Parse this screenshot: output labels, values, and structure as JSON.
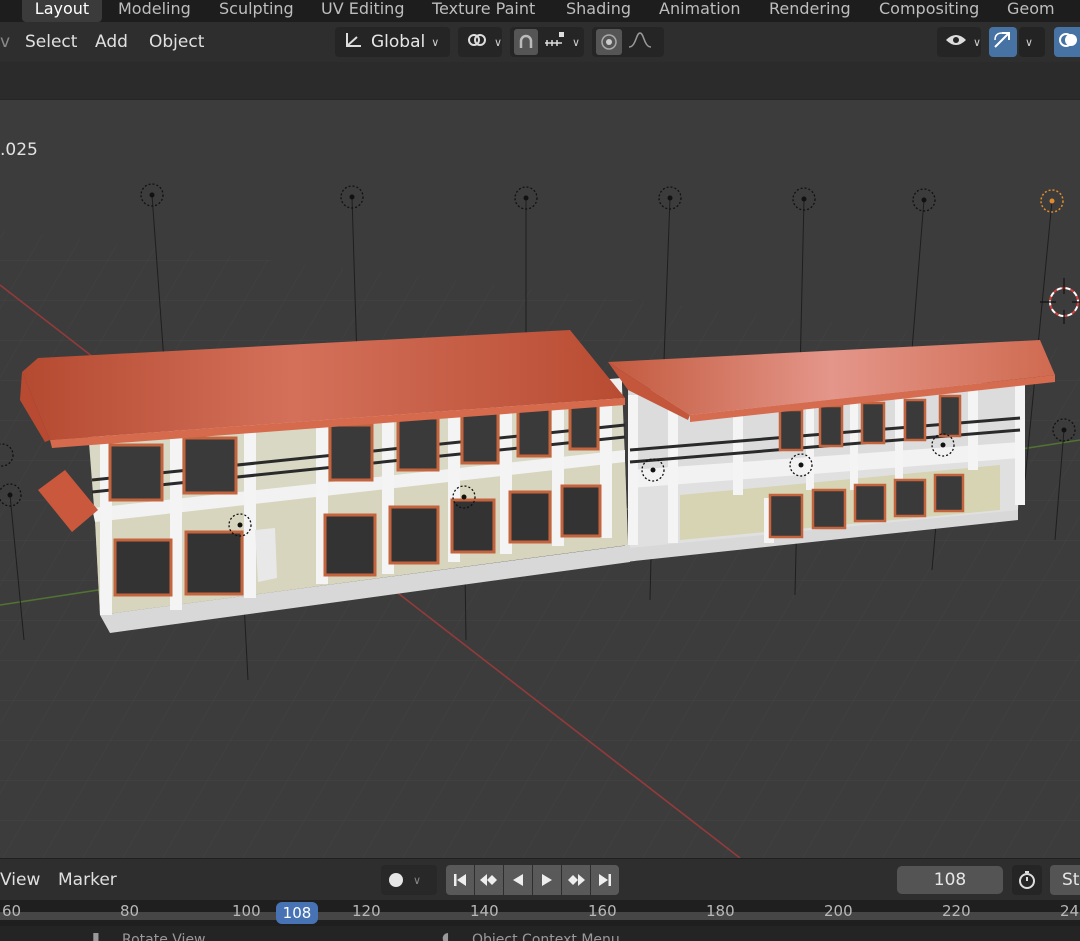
{
  "workspace_tabs": [
    "Layout",
    "Modeling",
    "Sculpting",
    "UV Editing",
    "Texture Paint",
    "Shading",
    "Animation",
    "Rendering",
    "Compositing",
    "Geom"
  ],
  "header": {
    "menu": [
      "Select",
      "Add",
      "Object"
    ],
    "transform_orientation": "Global"
  },
  "viewport": {
    "scale_text": ".025"
  },
  "timeline": {
    "menu": [
      "View",
      "Marker"
    ],
    "current_frame": "108",
    "start_label": "St",
    "ticks": [
      "60",
      "80",
      "100",
      "108",
      "120",
      "140",
      "160",
      "180",
      "200",
      "220",
      "24"
    ]
  },
  "status_bar": {
    "left": "Rotate View",
    "middle": "Object Context Menu"
  },
  "colors": {
    "roof": "#c8553a",
    "accent": "#4772b3",
    "grid_x_axis": "#b83a3a",
    "grid_y_axis": "#5a8a2e"
  }
}
